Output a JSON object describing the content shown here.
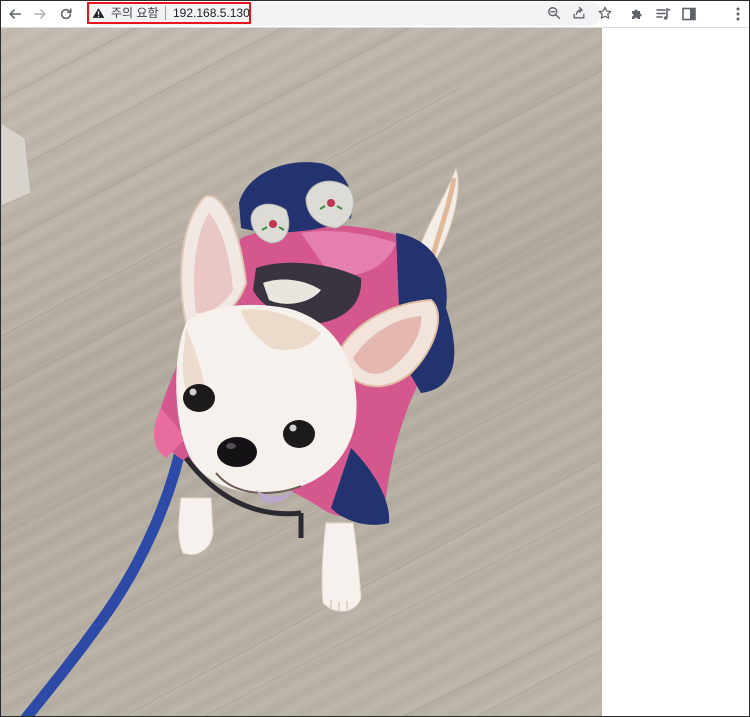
{
  "browser": {
    "security_label": "주의 요함",
    "url": "192.168.5.130"
  },
  "icons": {
    "back": "arrow-left",
    "forward": "arrow-right",
    "reload": "reload",
    "zoom": "magnifier",
    "share": "share",
    "bookmark": "star",
    "extensions": "puzzle-piece",
    "media": "playlist",
    "side_panel": "side-panel",
    "menu": "three-dots"
  },
  "colors": {
    "highlight_border": "#e8141b",
    "omnibox_bg": "#f1f3f4",
    "floor": "#b9b1a5",
    "hanbok_pink": "#d4588e",
    "hanbok_navy": "#23336f",
    "leash": "#2d4aa6"
  },
  "photo": {
    "subject": "chihuahua-in-hanbok"
  }
}
